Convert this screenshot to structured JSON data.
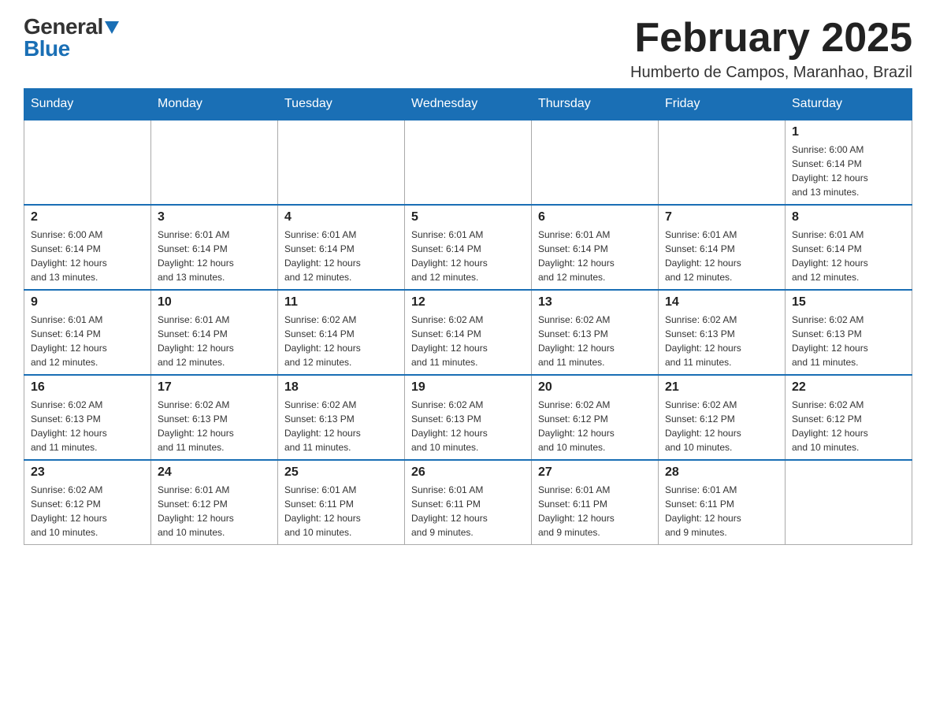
{
  "logo": {
    "general": "General",
    "blue": "Blue"
  },
  "header": {
    "month_year": "February 2025",
    "location": "Humberto de Campos, Maranhao, Brazil"
  },
  "days_header": [
    "Sunday",
    "Monday",
    "Tuesday",
    "Wednesday",
    "Thursday",
    "Friday",
    "Saturday"
  ],
  "weeks": [
    {
      "days": [
        {
          "num": "",
          "info": ""
        },
        {
          "num": "",
          "info": ""
        },
        {
          "num": "",
          "info": ""
        },
        {
          "num": "",
          "info": ""
        },
        {
          "num": "",
          "info": ""
        },
        {
          "num": "",
          "info": ""
        },
        {
          "num": "1",
          "info": "Sunrise: 6:00 AM\nSunset: 6:14 PM\nDaylight: 12 hours\nand 13 minutes."
        }
      ]
    },
    {
      "days": [
        {
          "num": "2",
          "info": "Sunrise: 6:00 AM\nSunset: 6:14 PM\nDaylight: 12 hours\nand 13 minutes."
        },
        {
          "num": "3",
          "info": "Sunrise: 6:01 AM\nSunset: 6:14 PM\nDaylight: 12 hours\nand 13 minutes."
        },
        {
          "num": "4",
          "info": "Sunrise: 6:01 AM\nSunset: 6:14 PM\nDaylight: 12 hours\nand 12 minutes."
        },
        {
          "num": "5",
          "info": "Sunrise: 6:01 AM\nSunset: 6:14 PM\nDaylight: 12 hours\nand 12 minutes."
        },
        {
          "num": "6",
          "info": "Sunrise: 6:01 AM\nSunset: 6:14 PM\nDaylight: 12 hours\nand 12 minutes."
        },
        {
          "num": "7",
          "info": "Sunrise: 6:01 AM\nSunset: 6:14 PM\nDaylight: 12 hours\nand 12 minutes."
        },
        {
          "num": "8",
          "info": "Sunrise: 6:01 AM\nSunset: 6:14 PM\nDaylight: 12 hours\nand 12 minutes."
        }
      ]
    },
    {
      "days": [
        {
          "num": "9",
          "info": "Sunrise: 6:01 AM\nSunset: 6:14 PM\nDaylight: 12 hours\nand 12 minutes."
        },
        {
          "num": "10",
          "info": "Sunrise: 6:01 AM\nSunset: 6:14 PM\nDaylight: 12 hours\nand 12 minutes."
        },
        {
          "num": "11",
          "info": "Sunrise: 6:02 AM\nSunset: 6:14 PM\nDaylight: 12 hours\nand 12 minutes."
        },
        {
          "num": "12",
          "info": "Sunrise: 6:02 AM\nSunset: 6:14 PM\nDaylight: 12 hours\nand 11 minutes."
        },
        {
          "num": "13",
          "info": "Sunrise: 6:02 AM\nSunset: 6:13 PM\nDaylight: 12 hours\nand 11 minutes."
        },
        {
          "num": "14",
          "info": "Sunrise: 6:02 AM\nSunset: 6:13 PM\nDaylight: 12 hours\nand 11 minutes."
        },
        {
          "num": "15",
          "info": "Sunrise: 6:02 AM\nSunset: 6:13 PM\nDaylight: 12 hours\nand 11 minutes."
        }
      ]
    },
    {
      "days": [
        {
          "num": "16",
          "info": "Sunrise: 6:02 AM\nSunset: 6:13 PM\nDaylight: 12 hours\nand 11 minutes."
        },
        {
          "num": "17",
          "info": "Sunrise: 6:02 AM\nSunset: 6:13 PM\nDaylight: 12 hours\nand 11 minutes."
        },
        {
          "num": "18",
          "info": "Sunrise: 6:02 AM\nSunset: 6:13 PM\nDaylight: 12 hours\nand 11 minutes."
        },
        {
          "num": "19",
          "info": "Sunrise: 6:02 AM\nSunset: 6:13 PM\nDaylight: 12 hours\nand 10 minutes."
        },
        {
          "num": "20",
          "info": "Sunrise: 6:02 AM\nSunset: 6:12 PM\nDaylight: 12 hours\nand 10 minutes."
        },
        {
          "num": "21",
          "info": "Sunrise: 6:02 AM\nSunset: 6:12 PM\nDaylight: 12 hours\nand 10 minutes."
        },
        {
          "num": "22",
          "info": "Sunrise: 6:02 AM\nSunset: 6:12 PM\nDaylight: 12 hours\nand 10 minutes."
        }
      ]
    },
    {
      "days": [
        {
          "num": "23",
          "info": "Sunrise: 6:02 AM\nSunset: 6:12 PM\nDaylight: 12 hours\nand 10 minutes."
        },
        {
          "num": "24",
          "info": "Sunrise: 6:01 AM\nSunset: 6:12 PM\nDaylight: 12 hours\nand 10 minutes."
        },
        {
          "num": "25",
          "info": "Sunrise: 6:01 AM\nSunset: 6:11 PM\nDaylight: 12 hours\nand 10 minutes."
        },
        {
          "num": "26",
          "info": "Sunrise: 6:01 AM\nSunset: 6:11 PM\nDaylight: 12 hours\nand 9 minutes."
        },
        {
          "num": "27",
          "info": "Sunrise: 6:01 AM\nSunset: 6:11 PM\nDaylight: 12 hours\nand 9 minutes."
        },
        {
          "num": "28",
          "info": "Sunrise: 6:01 AM\nSunset: 6:11 PM\nDaylight: 12 hours\nand 9 minutes."
        },
        {
          "num": "",
          "info": ""
        }
      ]
    }
  ]
}
